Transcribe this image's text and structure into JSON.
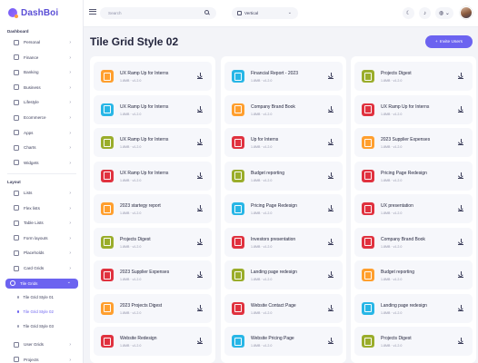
{
  "app": {
    "name": "DashBoi"
  },
  "header": {
    "search_placeholder": "Search",
    "layout_select": "Vertical",
    "theme_icon": "moon-icon",
    "notifications_icon": "bell-icon",
    "settings_icon": "gear-icon",
    "language_icon": "globe-icon"
  },
  "sidebar": {
    "dashboard_title": "Dashboard",
    "dashboard_items": [
      {
        "label": "Personal",
        "icon": "home-icon"
      },
      {
        "label": "Finance",
        "icon": "finance-icon"
      },
      {
        "label": "Banking",
        "icon": "bank-icon"
      },
      {
        "label": "Business",
        "icon": "briefcase-icon"
      },
      {
        "label": "Lifestyle",
        "icon": "lifestyle-icon"
      },
      {
        "label": "Ecommerce",
        "icon": "cart-icon"
      },
      {
        "label": "Apps",
        "icon": "apps-icon"
      },
      {
        "label": "Charts",
        "icon": "chart-icon"
      },
      {
        "label": "Widgets",
        "icon": "widget-icon"
      }
    ],
    "layout_title": "Layout",
    "layout_items": [
      {
        "label": "Lists",
        "icon": "list-icon"
      },
      {
        "label": "Flex lists",
        "icon": "flex-list-icon"
      },
      {
        "label": "Table Lists",
        "icon": "table-icon"
      },
      {
        "label": "Form layouts",
        "icon": "form-icon"
      },
      {
        "label": "Placeholds",
        "icon": "placeholder-icon"
      },
      {
        "label": "Card Grids",
        "icon": "card-grid-icon"
      },
      {
        "label": "Tile Grids",
        "icon": "tile-grid-icon"
      }
    ],
    "tile_grid_sub": [
      "Tile Grid Style 01",
      "Tile Grid Style 02",
      "Tile Grid Style 03"
    ],
    "bottom_items": [
      {
        "label": "User Grids",
        "icon": "user-grid-icon"
      },
      {
        "label": "Projects",
        "icon": "projects-icon"
      }
    ]
  },
  "page": {
    "title": "Tile Grid Style 02",
    "invite_button": "Invite Users"
  },
  "colors": {
    "orange": "#ff9f2e",
    "cyan": "#28b6e6",
    "olive": "#9aad2b",
    "red": "#e0323f",
    "accent": "#6c63f0"
  },
  "columns": [
    [
      {
        "title": "UX Ramp Up for Interns",
        "meta": "1.8MB · v1.2.0",
        "color": "orange"
      },
      {
        "title": "UX Ramp Up for Interns",
        "meta": "1.8MB · v1.2.0",
        "color": "cyan"
      },
      {
        "title": "UX Ramp Up for Interns",
        "meta": "1.8MB · v1.2.0",
        "color": "olive"
      },
      {
        "title": "UX Ramp Up for Interns",
        "meta": "1.8MB · v1.2.0",
        "color": "red"
      },
      {
        "title": "2023 startegy report",
        "meta": "1.8MB · v1.2.0",
        "color": "orange"
      },
      {
        "title": "Projects Digest",
        "meta": "1.8MB · v1.2.0",
        "color": "olive"
      },
      {
        "title": "2023 Supplier Expenses",
        "meta": "1.8MB · v1.2.0",
        "color": "red"
      },
      {
        "title": "2023 Projects Digest",
        "meta": "1.8MB · v1.2.0",
        "color": "orange"
      },
      {
        "title": "Website Redesign",
        "meta": "1.8MB · v1.2.0",
        "color": "red"
      }
    ],
    [
      {
        "title": "Financial Report - 2023",
        "meta": "1.8MB · v1.2.0",
        "color": "cyan"
      },
      {
        "title": "Company Brand Book",
        "meta": "1.8MB · v1.2.0",
        "color": "orange"
      },
      {
        "title": "Up for Interns",
        "meta": "1.8MB · v1.2.0",
        "color": "red"
      },
      {
        "title": "Budget reporting",
        "meta": "1.8MB · v1.2.0",
        "color": "olive"
      },
      {
        "title": "Pricing Page Redesign",
        "meta": "1.8MB · v1.2.0",
        "color": "cyan"
      },
      {
        "title": "Investors presentation",
        "meta": "1.8MB · v1.2.0",
        "color": "red"
      },
      {
        "title": "Landing page redesign",
        "meta": "1.8MB · v1.2.0",
        "color": "olive"
      },
      {
        "title": "Website Contact Page",
        "meta": "1.8MB · v1.2.0",
        "color": "red"
      },
      {
        "title": "Website Pricing Page",
        "meta": "1.8MB · v1.2.0",
        "color": "cyan"
      }
    ],
    [
      {
        "title": "Projects Digest",
        "meta": "1.8MB · v1.2.0",
        "color": "olive"
      },
      {
        "title": "UX Ramp Up for Interns",
        "meta": "1.8MB · v1.2.0",
        "color": "red"
      },
      {
        "title": "2023 Supplier Expenses",
        "meta": "1.8MB · v1.2.0",
        "color": "orange"
      },
      {
        "title": "Pricing Page Redesign",
        "meta": "1.8MB · v1.2.0",
        "color": "red"
      },
      {
        "title": "UX presentation",
        "meta": "1.8MB · v1.2.0",
        "color": "red"
      },
      {
        "title": "Company Brand Book",
        "meta": "1.8MB · v1.2.0",
        "color": "red"
      },
      {
        "title": "Budget reporting",
        "meta": "1.8MB · v1.2.0",
        "color": "orange"
      },
      {
        "title": "Landing page redesign",
        "meta": "1.8MB · v1.2.0",
        "color": "cyan"
      },
      {
        "title": "Projects Digest",
        "meta": "1.8MB · v1.2.0",
        "color": "olive"
      }
    ]
  ]
}
